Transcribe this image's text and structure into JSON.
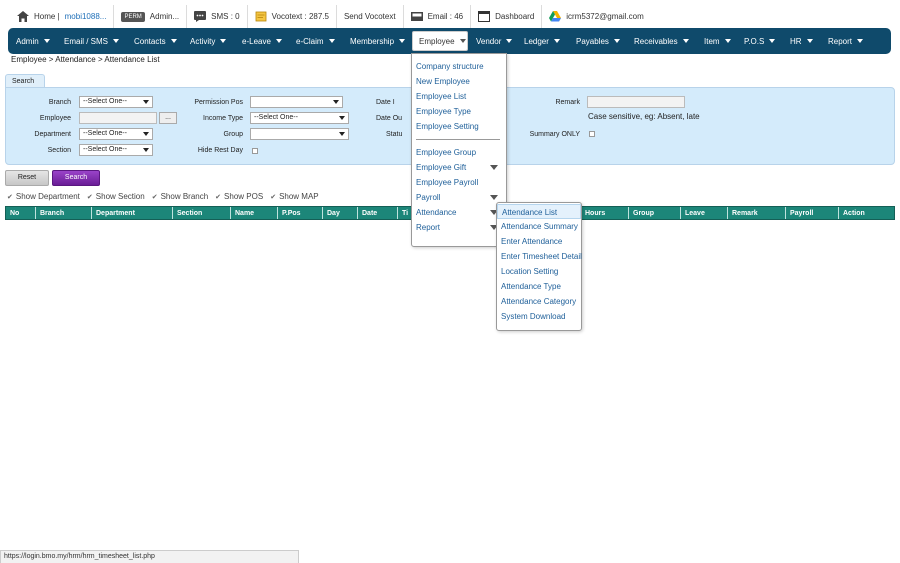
{
  "topbar": {
    "home_label": "Home |",
    "home_user": "mobi1088...",
    "perm_badge": "PERM",
    "admin_label": "Admin...",
    "sms": "SMS : 0",
    "vocotext": "Vocotext : 287.5",
    "send_vocotext": "Send Vocotext",
    "email": "Email : 46",
    "dashboard": "Dashboard",
    "account": "icrm5372@gmail.com"
  },
  "nav": {
    "items": [
      "Admin",
      "Email / SMS",
      "Contacts",
      "Activity",
      "e-Leave",
      "e-Claim",
      "Membership",
      "Employee",
      "Vendor",
      "Ledger",
      "Payables",
      "Receivables",
      "Item",
      "P.O.S",
      "HR",
      "Report"
    ],
    "active": "Employee"
  },
  "breadcrumb": "Employee > Attendance > Attendance List",
  "search": {
    "tab_label": "Search",
    "branch_label": "Branch",
    "branch_value": "--Select One--",
    "employee_label": "Employee",
    "employee_btn": "...",
    "department_label": "Department",
    "department_value": "--Select One--",
    "section_label": "Section",
    "section_value": "--Select One--",
    "permission_label": "Permission Pos",
    "income_label": "Income Type",
    "income_value": "--Select One--",
    "group_label": "Group",
    "hide_rest_label": "Hide Rest Day",
    "date_in_label": "Date I",
    "date_out_label": "Date Ou",
    "status_label": "Statu",
    "remark_label": "Remark",
    "remark_note": "Case sensitive, eg: Absent, late",
    "summary_label": "Summary ONLY",
    "reset_btn": "Reset",
    "search_btn": "Search"
  },
  "show_options": [
    "Show Department",
    "Show Section",
    "Show Branch",
    "Show POS",
    "Show MAP"
  ],
  "table": {
    "columns": [
      "No",
      "Branch",
      "Department",
      "Section",
      "Name",
      "P.Pos",
      "Day",
      "Date",
      "Ti",
      "Hours",
      "Group",
      "Leave",
      "Remark",
      "Payroll",
      "Action"
    ]
  },
  "employee_menu": {
    "group1": [
      "Company structure",
      "New Employee",
      "Employee List",
      "Employee Type",
      "Employee Setting"
    ],
    "group2": [
      {
        "label": "Employee Group",
        "sub": false
      },
      {
        "label": "Employee Gift",
        "sub": true
      },
      {
        "label": "Employee Payroll",
        "sub": false
      },
      {
        "label": "Payroll",
        "sub": true
      },
      {
        "label": "Attendance",
        "sub": true
      },
      {
        "label": "Report",
        "sub": true
      }
    ]
  },
  "attendance_menu": [
    "Attendance List",
    "Attendance Summary",
    "Enter Attendance",
    "Enter Timesheet Detail",
    "Location Setting",
    "Attendance Type",
    "Attendance Category",
    "System Download"
  ],
  "statusbar": "https://login.bmo.my/hrm/hrm_timesheet_list.php",
  "colors": {
    "nav_bg": "#0f4a6b",
    "panel_bg": "#d4ebfb",
    "table_header": "#1c8679",
    "search_btn": "#7a2aa8"
  }
}
